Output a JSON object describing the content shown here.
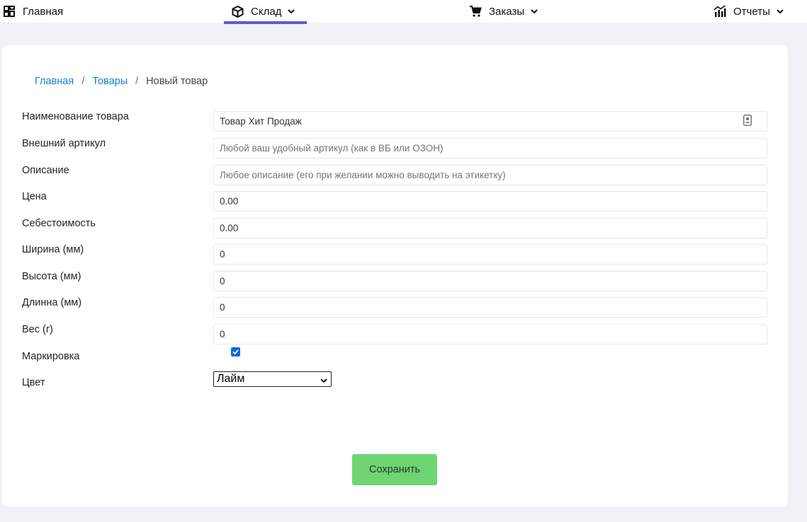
{
  "nav": {
    "home": {
      "label": "Главная",
      "icon": "dashboard-grid-icon"
    },
    "sklad": {
      "label": "Склад",
      "icon": "box-icon"
    },
    "orders": {
      "label": "Заказы",
      "icon": "cart-icon"
    },
    "reports": {
      "label": "Отчеты",
      "icon": "chart-icon"
    },
    "active_color": "#5660d6"
  },
  "breadcrumb": {
    "home": "Главная",
    "products": "Товары",
    "current": "Новый товар"
  },
  "form": {
    "name_label": "Наименование товара",
    "name_value": "Товар Хит Продаж",
    "article_label": "Внешний артикул",
    "article_placeholder": "Любой ваш удобный артикул (как в ВБ или ОЗОН)",
    "description_label": "Описание",
    "description_placeholder": "Любое описание (его при желании можно выводить на этикетку)",
    "price_label": "Цена",
    "price_value": "0.00",
    "cost_label": "Себестоимость",
    "cost_value": "0.00",
    "width_label": "Ширина (мм)",
    "width_value": "0",
    "height_label": "Высота (мм)",
    "height_value": "0",
    "length_label": "Длинна (мм)",
    "length_value": "0",
    "weight_label": "Вес (г)",
    "weight_value": "0",
    "marking_label": "Маркировка",
    "marking_checked": true,
    "color_label": "Цвет",
    "color_value": "Лайм"
  },
  "save_button": {
    "label": "Сохранить",
    "color": "#6fd474"
  }
}
